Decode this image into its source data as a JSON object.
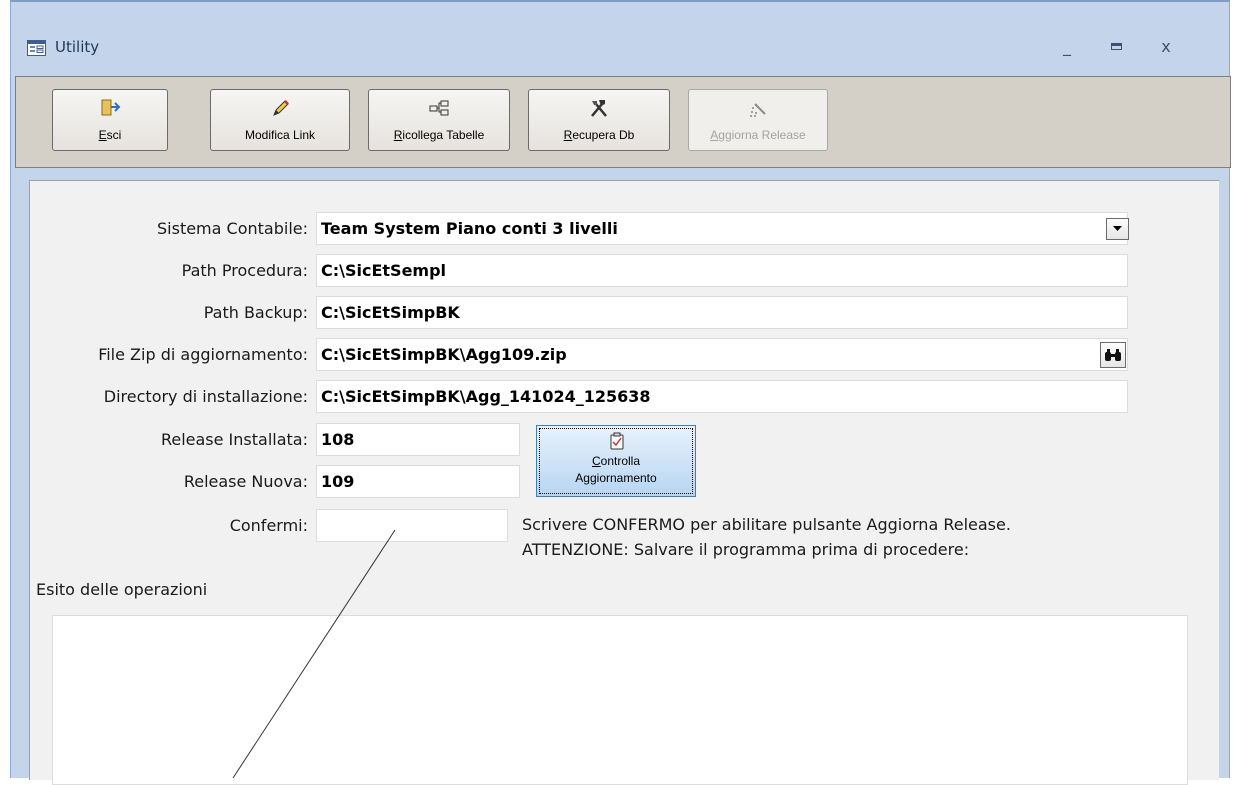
{
  "window": {
    "title": "Utility",
    "controls": {
      "minimize": "_",
      "maximize": "▭",
      "close": "x"
    }
  },
  "toolbar": {
    "buttons": [
      {
        "id": "esci",
        "label": "Esci",
        "enabled": true
      },
      {
        "id": "modifica_link",
        "label": "Modifica Link",
        "enabled": true
      },
      {
        "id": "ricollega_tabelle",
        "label": "Ricollega Tabelle",
        "enabled": true
      },
      {
        "id": "recupera_db",
        "label": "Recupera Db",
        "enabled": true
      },
      {
        "id": "aggiorna_release",
        "label": "Aggiorna Release",
        "enabled": false
      }
    ]
  },
  "form": {
    "sistema_contabile": {
      "label": "Sistema Contabile:",
      "value": "Team System Piano conti 3 livelli"
    },
    "path_procedura": {
      "label": "Path Procedura:",
      "value": "C:\\SicEtSempl"
    },
    "path_backup": {
      "label": "Path Backup:",
      "value": "C:\\SicEtSimpBK"
    },
    "file_zip": {
      "label": "File Zip di aggiornamento:",
      "value": "C:\\SicEtSimpBK\\Agg109.zip"
    },
    "directory_installazione": {
      "label": "Directory di installazione:",
      "value": "C:\\SicEtSimpBK\\Agg_141024_125638"
    },
    "release_installata": {
      "label": "Release Installata:",
      "value": "108"
    },
    "release_nuova": {
      "label": "Release Nuova:",
      "value": "109"
    },
    "controlla_button": {
      "line1": "Controlla",
      "line2": "Aggiornamento"
    },
    "confermi": {
      "label": "Confermi:",
      "value": ""
    },
    "note_line1": "Scrivere CONFERMO per abilitare pulsante Aggiorna Release.",
    "note_line2": "ATTENZIONE: Salvare il programma prima di procedere:",
    "esito_label": "Esito delle operazioni",
    "esito_text": ""
  },
  "colors": {
    "window_frame": "#c4d4ea",
    "toolbar_bg": "#d4d0c8",
    "form_bg": "#f1f1f1",
    "focused_button": "#b7d5f2"
  }
}
